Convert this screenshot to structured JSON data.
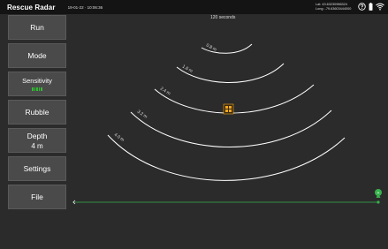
{
  "app": {
    "title": "Rescue Radar",
    "datetime": "19-01-22 · 10:06:36",
    "lat": "Lat: 43.63230986324",
    "long": "Long: -79.63603444000"
  },
  "status_icons": [
    "help-icon",
    "battery-icon",
    "wifi-icon"
  ],
  "sidebar": {
    "run": "Run",
    "mode": "Mode",
    "sensitivity": "Sensitivity",
    "sensitivity_level": 5,
    "rubble": "Rubble",
    "depth_label": "Depth",
    "depth_value": "4 m",
    "settings": "Settings",
    "file": "File"
  },
  "radar": {
    "time_label": "120 seconds",
    "rings": [
      "0.8 m",
      "1.6 m",
      "2.4 m",
      "3.2 m",
      "4.0 m"
    ],
    "target_color": "#f2a81d",
    "slider_color": "#37b24d",
    "accent": "#2fbf2f"
  }
}
